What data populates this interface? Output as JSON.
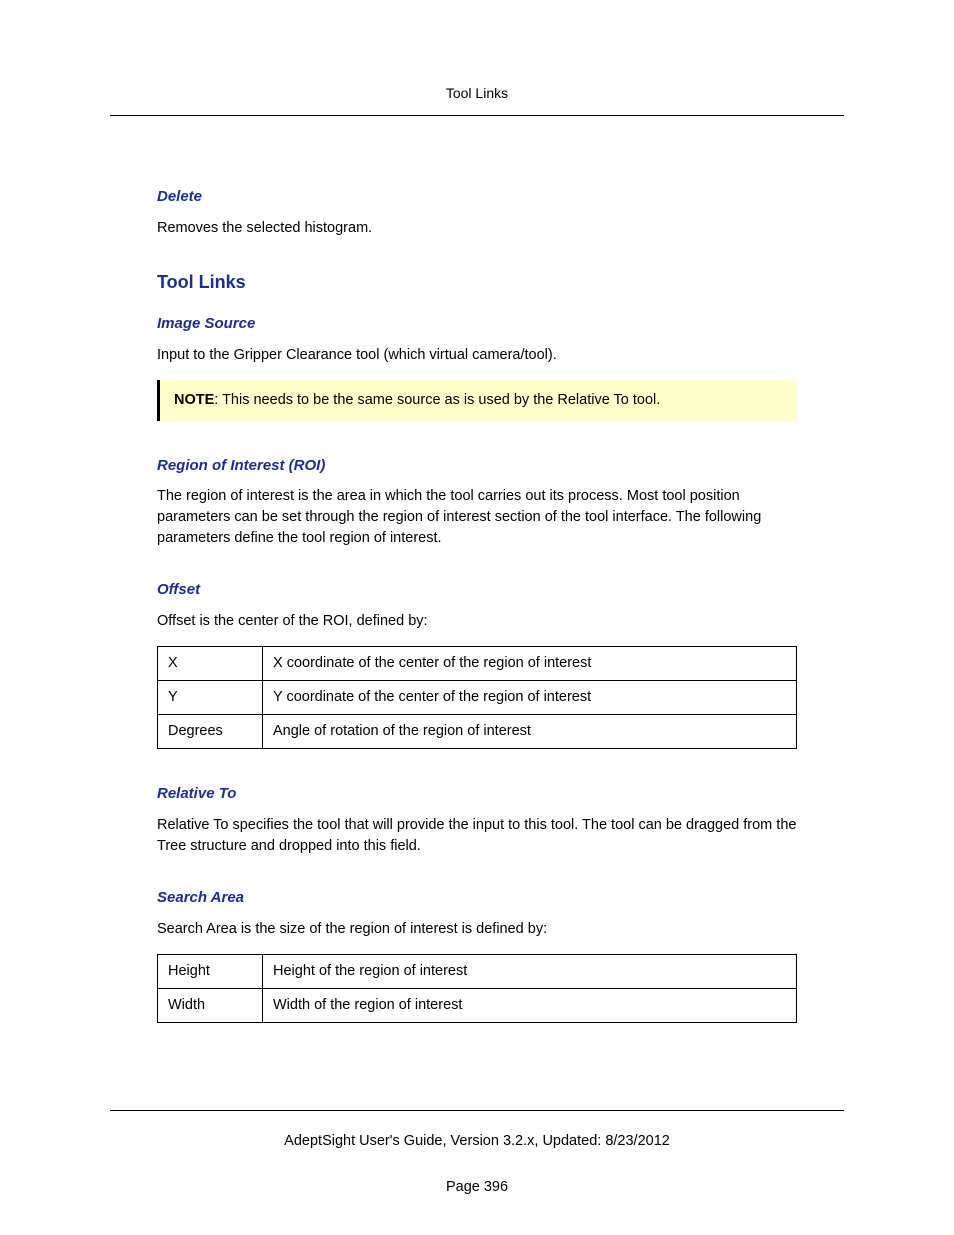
{
  "header": {
    "title": "Tool Links"
  },
  "sections": {
    "delete": {
      "heading": "Delete",
      "body": "Removes the selected histogram."
    },
    "tool_links": {
      "heading": "Tool Links"
    },
    "image_source": {
      "heading": "Image Source",
      "body": "Input to the Gripper Clearance tool (which virtual camera/tool).",
      "note_label": "NOTE",
      "note_body": ": This needs to be the same source as is used by the Relative To tool."
    },
    "roi": {
      "heading": "Region of Interest (ROI)",
      "body": "The region of interest is the area in which the tool carries out its process. Most tool position parameters can be set through the region of interest section of the tool interface. The following parameters define the tool region of interest."
    },
    "offset": {
      "heading": "Offset",
      "body": "Offset is the center of the ROI, defined by:",
      "rows": [
        {
          "k": "X",
          "v": "X coordinate of the center of the region of interest"
        },
        {
          "k": "Y",
          "v": "Y coordinate of the center of the region of interest"
        },
        {
          "k": "Degrees",
          "v": "Angle of rotation of the region of interest"
        }
      ]
    },
    "relative_to": {
      "heading": "Relative To",
      "body": "Relative To specifies the tool that will provide the input to this tool. The tool can be dragged from the Tree structure and dropped into this field."
    },
    "search_area": {
      "heading": "Search Area",
      "body": "Search Area is the size of the region of interest is defined by:",
      "rows": [
        {
          "k": "Height",
          "v": "Height of the region of interest"
        },
        {
          "k": "Width",
          "v": "Width of the region of interest"
        }
      ]
    }
  },
  "footer": {
    "line": "AdeptSight User's Guide,  Version 3.2.x, Updated: 8/23/2012",
    "page": "Page 396"
  }
}
